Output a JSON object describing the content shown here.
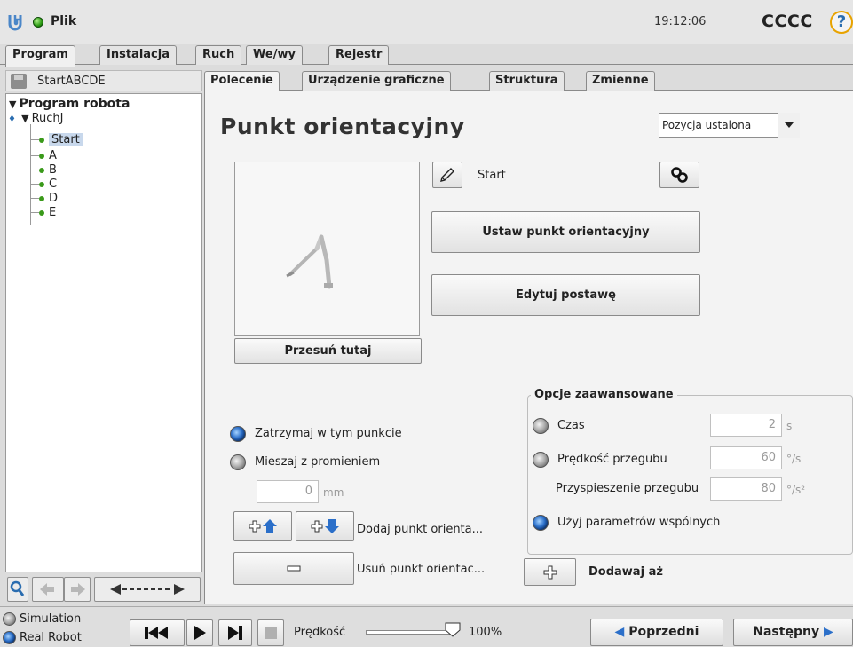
{
  "header": {
    "app_title": "Plik",
    "clock": "19:12:06",
    "robot_name": "CCCC",
    "help_label": "?"
  },
  "main_tabs": [
    {
      "label": "Program",
      "active": true
    },
    {
      "label": "Instalacja",
      "active": false
    },
    {
      "label": "Ruch",
      "active": false
    },
    {
      "label": "We/wy",
      "active": false
    },
    {
      "label": "Rejestr",
      "active": false
    }
  ],
  "program": {
    "name": "StartABCDE",
    "tree": {
      "root": "Program robota",
      "move": "RuchJ",
      "waypoints": [
        "Start",
        "A",
        "B",
        "C",
        "D",
        "E"
      ]
    }
  },
  "sub_tabs": [
    {
      "label": "Polecenie",
      "active": true
    },
    {
      "label": "Urządzenie graficzne",
      "active": false
    },
    {
      "label": "Struktura",
      "active": false
    },
    {
      "label": "Zmienne",
      "active": false
    }
  ],
  "waypoint_panel": {
    "title": "Punkt orientacyjny",
    "type_dropdown": "Pozycja ustalona",
    "waypoint_name": "Start",
    "set_waypoint_button": "Ustaw punkt orientacyjny",
    "edit_pose_button": "Edytuj postawę",
    "move_here_button": "Przesuń tutaj",
    "stop_at_point": "Zatrzymaj w tym punkcie",
    "blend_with_radius": "Mieszaj z promieniem",
    "blend_radius_value": "0",
    "blend_radius_unit": "mm",
    "add_waypoint_label": "Dodaj punkt orienta...",
    "remove_waypoint_label": "Usuń punkt orientac...",
    "advanced": {
      "title": "Opcje zaawansowane",
      "time_label": "Czas",
      "time_value": "2",
      "time_unit": "s",
      "joint_speed_label": "Prędkość przegubu",
      "joint_speed_value": "60",
      "joint_speed_unit": "°/s",
      "joint_accel_label": "Przyspieszenie przegubu",
      "joint_accel_value": "80",
      "joint_accel_unit": "°/s²",
      "shared_params_label": "Użyj parametrów wspólnych"
    },
    "add_until_label": "Dodawaj aż"
  },
  "bottom_bar": {
    "simulation_label": "Simulation",
    "real_robot_label": "Real Robot",
    "speed_label": "Prędkość",
    "speed_value": "100%",
    "speed_fraction": 1.0,
    "prev_button": "Poprzedni",
    "next_button": "Następny"
  },
  "colors": {
    "accent_blue": "#2b6fc9",
    "active_green": "#3a9a1a",
    "help_ring": "#e8a300"
  }
}
